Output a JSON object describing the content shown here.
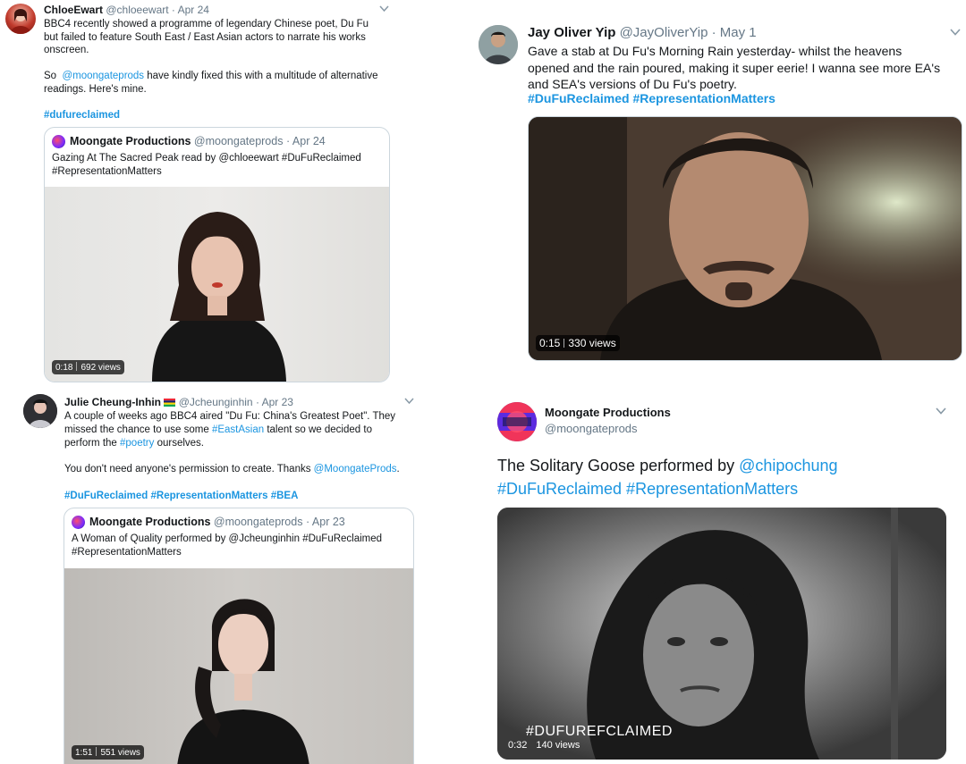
{
  "tweets": {
    "chloe": {
      "name": "ChloeEwart",
      "handle": "@chloeewart",
      "date": "· Apr 24",
      "text_line1": "BBC4 recently showed a programme of legendary Chinese poet, Du Fu",
      "text_line2": "but failed to feature South East / East Asian actors to narrate his works",
      "text_line3": "onscreen.",
      "so_prefix": "So",
      "so_mention": "@moongateprods",
      "so_rest": "have kindly fixed this with a multitude of alternative",
      "text_line5": "readings. Here's mine.",
      "hashtag": "#dufureclaimed",
      "quote": {
        "name": "Moongate Productions",
        "handle": "@moongateprods",
        "date": "· Apr 24",
        "text": "Gazing At The Sacred Peak read by @chloeewart #DuFuReclaimed\n#RepresentationMatters"
      },
      "video": {
        "time": "0:18",
        "views": "692 views"
      }
    },
    "jay": {
      "name": "Jay Oliver Yip",
      "handle": "@JayOliverYip",
      "date": "· May 1",
      "text": "Gave a stab at Du Fu's Morning Rain yesterday- whilst the heavens\nopened and the rain poured, making it super eerie! I wanna see more EA's\nand SEA's versions of Du Fu's poetry.",
      "hashtags": "#DuFuReclaimed #RepresentationMatters",
      "video": {
        "time": "0:15",
        "views": "330 views"
      }
    },
    "julie": {
      "name": "Julie Cheung-Inhin",
      "handle": "@Jcheunginhin",
      "date": "· Apr 23",
      "line1": "A couple of weeks ago BBC4 aired \"Du Fu: China's Greatest Poet\". They",
      "line2_prefix": "missed the chance to use some",
      "line2_tag": "#EastAsian",
      "line2_rest": "talent so we decided to",
      "line3_prefix": "perform the",
      "line3_tag": "#poetry",
      "line3_rest": "ourselves.",
      "line4_prefix": "You don't need anyone's permission to create. Thanks",
      "line4_mention": "@MoongateProds",
      "line4_rest": ".",
      "hashtags": "#DuFuReclaimed #RepresentationMatters #BEA",
      "quote": {
        "name": "Moongate Productions",
        "handle": "@moongateprods",
        "date": "· Apr 23",
        "text": "A Woman of Quality performed by @Jcheunginhin #DuFuReclaimed\n#RepresentationMatters"
      },
      "video": {
        "time": "1:51",
        "views": "551 views"
      }
    },
    "moongate": {
      "name": "Moongate Productions",
      "handle": "@moongateprods",
      "text_prefix": "The Solitary Goose performed by",
      "mention": "@chipochung",
      "hashtags": "#DuFuReclaimed #RepresentationMatters",
      "video": {
        "overlay": "#DUFUREFCLAIMED",
        "time": "0:32",
        "views": "140 views"
      }
    }
  },
  "icons": {
    "chevron": "chevron-down-icon",
    "flag": "mauritius-flag-icon",
    "logo": "moongate-logo"
  },
  "colors": {
    "link": "#1b95e0",
    "text": "#14171a",
    "muted": "#657786",
    "border": "#ccd6dd"
  }
}
